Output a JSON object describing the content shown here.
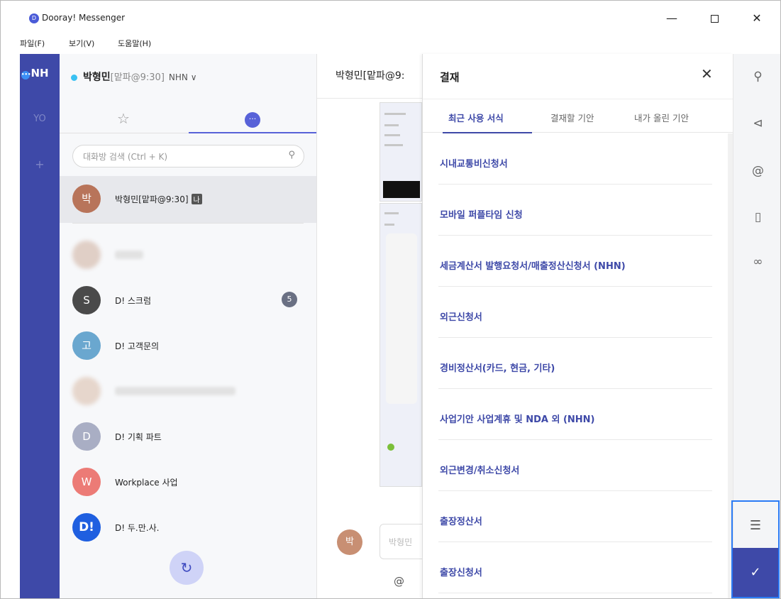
{
  "window": {
    "title": "Dooray! Messenger",
    "logo_text": "D",
    "minimize": "—",
    "close": "✕"
  },
  "menu": {
    "file": "파일(F)",
    "view": "보기(V)",
    "help": "도움말(H)"
  },
  "rail": {
    "workspaces": [
      {
        "label": "NH",
        "badge": "•••"
      },
      {
        "label": "YO"
      }
    ],
    "add": "+"
  },
  "sidebar": {
    "user_name": "박형민",
    "user_status": "[맡파@9:30]",
    "user_org": "NHN ∨",
    "search_placeholder": "대화방 검색 (Ctrl + K)",
    "chats": [
      {
        "name": "박형민[맡파@9:30]",
        "badge": "나",
        "avatar": "박"
      },
      {
        "name": "",
        "avatar": ""
      },
      {
        "name": "D! 스크럼",
        "count": "5",
        "avatar": "S"
      },
      {
        "name": "D! 고객문의",
        "avatar": "고"
      },
      {
        "name": "",
        "avatar": ""
      },
      {
        "name": "D! 기획 파트",
        "avatar": "D"
      },
      {
        "name": "Workplace 사업",
        "avatar": "W"
      },
      {
        "name": "D! 두.만.사.",
        "avatar": "D!"
      }
    ],
    "refresh_icon": "↻"
  },
  "chat": {
    "room_title": "박형민[맡파@9:",
    "input_placeholder": "박형민",
    "at_symbol": "@",
    "avatar_text": "박"
  },
  "panel": {
    "title": "결재",
    "close": "✕",
    "tabs": [
      "최근 사용 서식",
      "결재할 기안",
      "내가 올린 기안"
    ],
    "forms": [
      "시내교통비신청서",
      "모바일 퍼플타임 신청",
      "세금계산서 발행요청서/매출정산신청서 (NHN)",
      "외근신청서",
      "경비정산서(카드, 현금, 기타)",
      "사업기안 사업계휴 및 NDA 외 (NHN)",
      "외근변경/취소신청서",
      "출장정산서",
      "출장신청서"
    ]
  },
  "colors": {
    "accent": "#3e49a8",
    "highlight": "#2b7bf5",
    "online": "#39c1f2"
  }
}
